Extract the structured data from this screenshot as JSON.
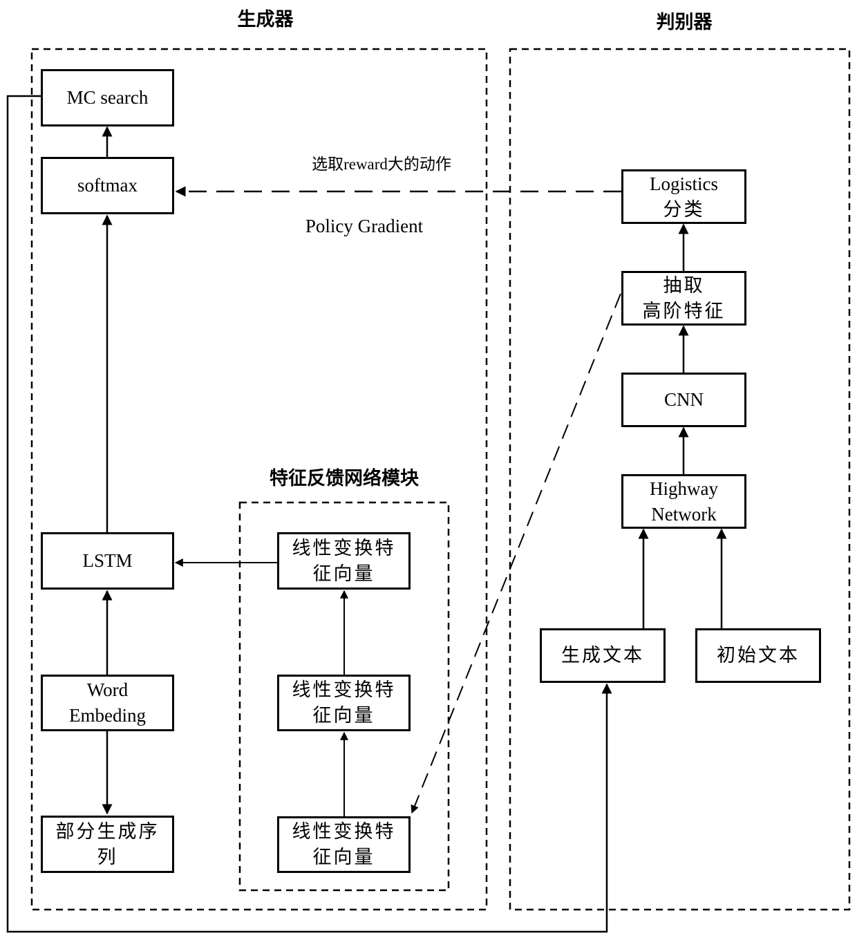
{
  "diagram": {
    "generator": {
      "title": "生成器",
      "nodes": {
        "mc_search": "MC search",
        "softmax": "softmax",
        "lstm": "LSTM",
        "word_embedding": [
          "Word",
          "Embeding"
        ],
        "partial_sequence": [
          "部分生成序",
          "列"
        ]
      },
      "feedback_module": {
        "title": "特征反馈网络模块",
        "nodes": [
          [
            "线性变换特",
            "征向量"
          ],
          [
            "线性变换特",
            "征向量"
          ],
          [
            "线性变换特",
            "征向量"
          ]
        ]
      }
    },
    "discriminator": {
      "title": "判别器",
      "nodes": {
        "logistics": [
          "Logistics",
          "分类"
        ],
        "extract_features": [
          "抽取",
          "高阶特征"
        ],
        "cnn": "CNN",
        "highway": [
          "Highway",
          "Network"
        ],
        "generated_text": "生成文本",
        "original_text": "初始文本"
      }
    },
    "annotations": {
      "reward_label": "选取reward大的动作",
      "policy_gradient": "Policy Gradient"
    },
    "edges": [
      {
        "from": "softmax",
        "to": "mc_search",
        "style": "solid"
      },
      {
        "from": "lstm",
        "to": "softmax",
        "style": "solid"
      },
      {
        "from": "word_embedding",
        "to": "lstm",
        "style": "solid"
      },
      {
        "from": "word_embedding",
        "to": "partial_sequence",
        "style": "solid"
      },
      {
        "from": "feedback_top",
        "to": "lstm",
        "style": "solid"
      },
      {
        "from": "feedback_mid",
        "to": "feedback_top",
        "style": "solid"
      },
      {
        "from": "feedback_bottom",
        "to": "feedback_mid",
        "style": "solid"
      },
      {
        "from": "logistics",
        "to": "softmax",
        "style": "dashed"
      },
      {
        "from": "extract_features",
        "to": "feedback_bottom",
        "style": "dashed"
      },
      {
        "from": "extract_features",
        "to": "logistics",
        "style": "solid"
      },
      {
        "from": "cnn",
        "to": "extract_features",
        "style": "solid"
      },
      {
        "from": "highway",
        "to": "cnn",
        "style": "solid"
      },
      {
        "from": "generated_text",
        "to": "highway",
        "style": "solid"
      },
      {
        "from": "original_text",
        "to": "highway",
        "style": "solid"
      },
      {
        "from": "mc_search",
        "to": "generated_text",
        "style": "solid"
      }
    ]
  }
}
